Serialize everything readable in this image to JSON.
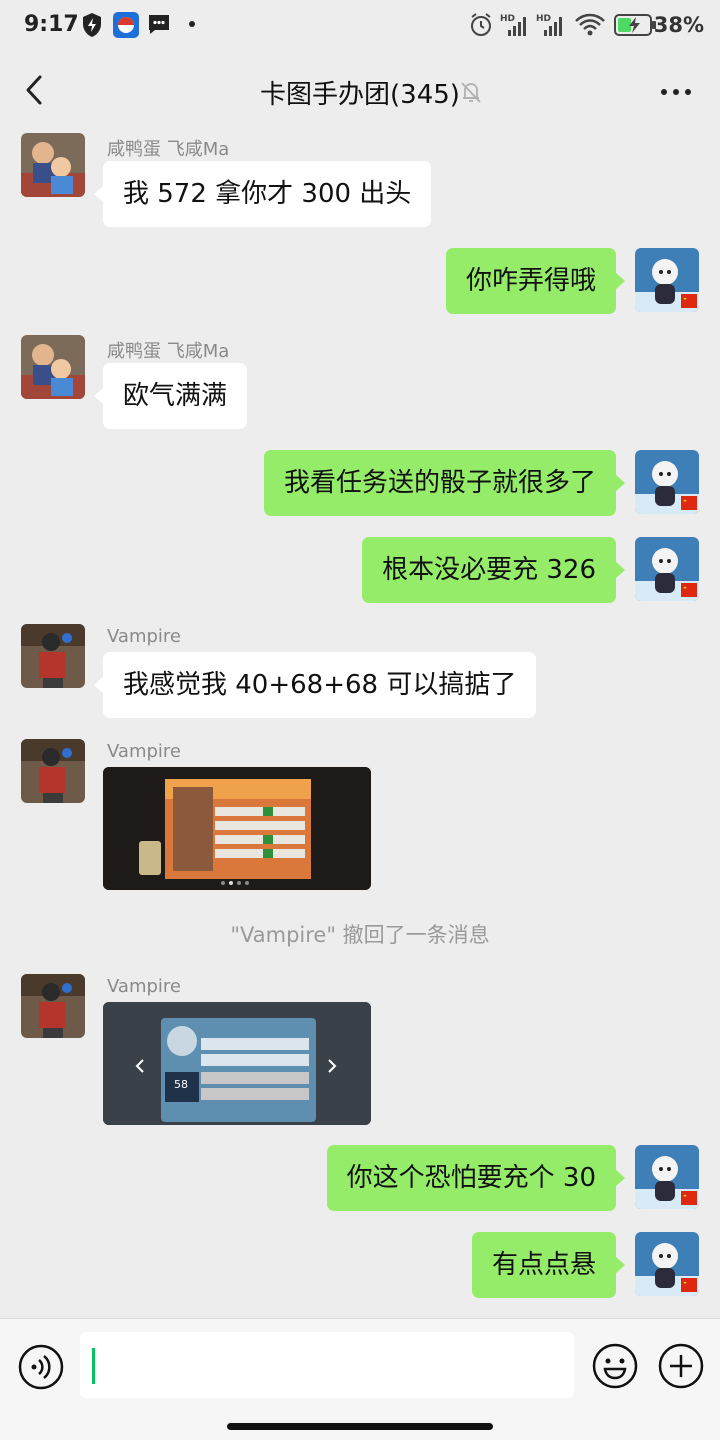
{
  "status_bar": {
    "time": "9:17",
    "battery": "38%",
    "icons": [
      "shield-bolt-icon",
      "browser-app-icon",
      "message-app-icon",
      "alarm-icon",
      "hd-signal-icon",
      "hd-signal-icon",
      "wifi-icon",
      "battery-charging-icon"
    ]
  },
  "header": {
    "title": "卡图手办团(345)",
    "back_icon": "chevron-left-icon",
    "mute_icon": "bell-off-icon",
    "more_icon": "more-dots-icon"
  },
  "messages": [
    {
      "type": "text",
      "direction": "in",
      "sender": "咸鸭蛋 飞咸Ma",
      "text": "我 572 拿你才 300 出头"
    },
    {
      "type": "text",
      "direction": "out",
      "text": "你咋弄得哦"
    },
    {
      "type": "text",
      "direction": "in",
      "sender": "咸鸭蛋 飞咸Ma",
      "text": "欧气满满"
    },
    {
      "type": "text",
      "direction": "out",
      "text": "我看任务送的骰子就很多了"
    },
    {
      "type": "text",
      "direction": "out",
      "text": "根本没必要充 326"
    },
    {
      "type": "text",
      "direction": "in",
      "sender": "Vampire",
      "text": "我感觉我 40+68+68 可以搞掂了"
    },
    {
      "type": "image",
      "direction": "in",
      "sender": "Vampire"
    },
    {
      "type": "system",
      "text": "\"Vampire\" 撤回了一条消息"
    },
    {
      "type": "image",
      "direction": "in",
      "sender": "Vampire",
      "caption_number": "58"
    },
    {
      "type": "text",
      "direction": "out",
      "text": "你这个恐怕要充个 30"
    },
    {
      "type": "text",
      "direction": "out",
      "text": "有点点悬"
    }
  ],
  "input_bar": {
    "voice_icon": "voice-icon",
    "emoji_icon": "emoji-icon",
    "plus_icon": "plus-circle-icon",
    "input_value": ""
  },
  "colors": {
    "background": "#ededed",
    "incoming_bubble": "#ffffff",
    "outgoing_bubble": "#95ec69",
    "caret": "#07c160"
  }
}
